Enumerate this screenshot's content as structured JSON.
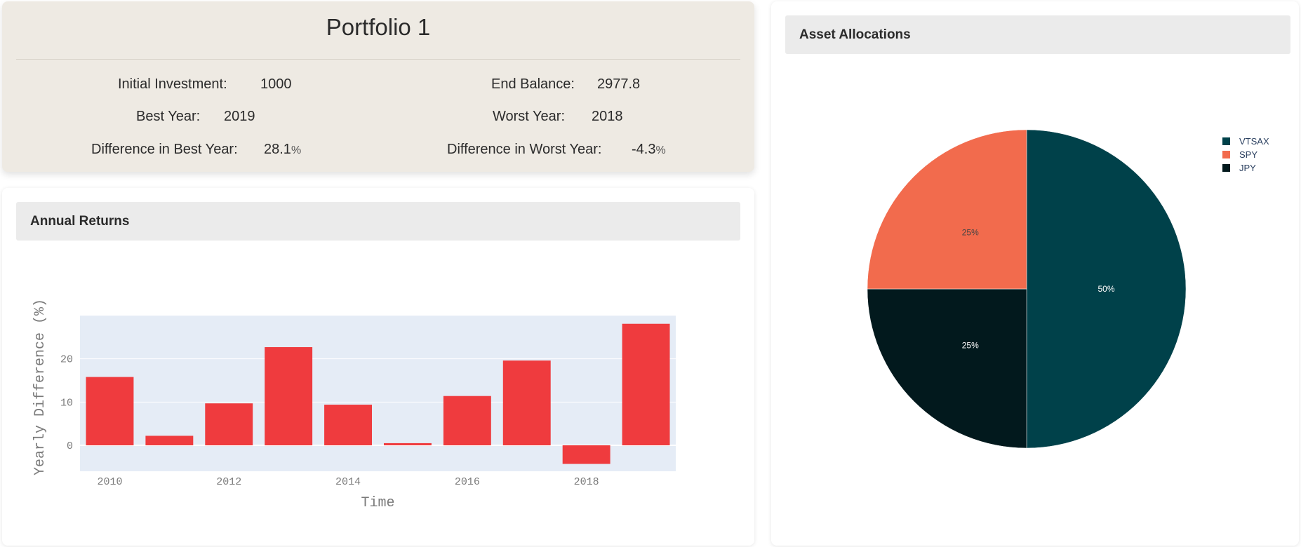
{
  "summary": {
    "title": "Portfolio 1",
    "initial_investment": {
      "label": "Initial Investment:",
      "value": "1000"
    },
    "end_balance": {
      "label": "End Balance:",
      "value": "2977.8"
    },
    "best_year": {
      "label": "Best Year:",
      "value": "2019"
    },
    "worst_year": {
      "label": "Worst Year:",
      "value": "2018"
    },
    "best_diff": {
      "label": "Difference in Best Year:",
      "value": "28.1",
      "unit": "%"
    },
    "worst_diff": {
      "label": "Difference in Worst Year:",
      "value": "-4.3",
      "unit": "%"
    }
  },
  "returns_panel": {
    "title": "Annual Returns"
  },
  "allocation_panel": {
    "title": "Asset Allocations"
  },
  "colors": {
    "bar": "#ef3b3e",
    "plot_bg": "#e5ecf6",
    "vtsax": "#00414a",
    "spy": "#f26b4d",
    "jpy": "#02191d"
  },
  "chart_data": [
    {
      "type": "bar",
      "x": [
        2010,
        2011,
        2012,
        2013,
        2014,
        2015,
        2016,
        2017,
        2018,
        2019
      ],
      "values": [
        15.8,
        2.2,
        9.7,
        22.7,
        9.4,
        0.5,
        11.4,
        19.6,
        -4.3,
        28.1
      ],
      "xlabel": "Time",
      "ylabel": "Yearly Difference (%)",
      "xticks": [
        "2010",
        "2012",
        "2014",
        "2016",
        "2018"
      ],
      "yticks": [
        "0",
        "10",
        "20"
      ],
      "ylim": [
        -6,
        30
      ],
      "grid": true
    },
    {
      "type": "pie",
      "labels": [
        "VTSAX",
        "SPY",
        "JPY"
      ],
      "values": [
        50,
        25,
        25
      ],
      "slice_labels": [
        "50%",
        "25%",
        "25%"
      ],
      "legend": "top-right"
    }
  ]
}
